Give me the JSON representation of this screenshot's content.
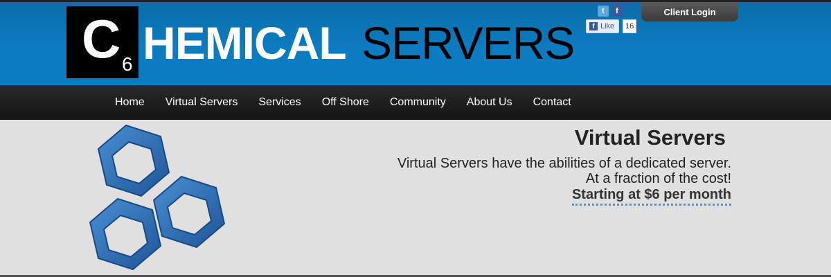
{
  "logo": {
    "box_letter": "C",
    "box_subscript": "6",
    "word_bold": "HEMICAL",
    "word_regular": "SERVERS"
  },
  "social": {
    "twitter_icon": "t",
    "facebook_icon": "f",
    "like_label": "Like",
    "like_count": "16"
  },
  "client_login": "Client Login",
  "nav": [
    "Home",
    "Virtual Servers",
    "Services",
    "Off Shore",
    "Community",
    "About Us",
    "Contact"
  ],
  "hero": {
    "title": "Virtual Servers",
    "line1": "Virtual Servers have the abilities of a dedicated server.",
    "line2": "At a fraction of the cost!",
    "price": "Starting at $6 per month"
  },
  "colors": {
    "header_blue": "#0c7cc2",
    "hex_blue": "#2a6db5",
    "nav_dark": "#1c1c1c"
  }
}
